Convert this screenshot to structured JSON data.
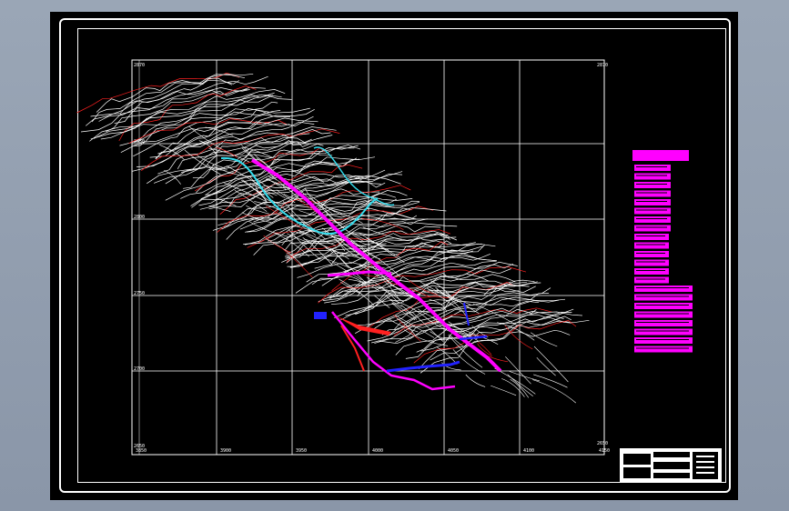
{
  "drawing": {
    "grid_labels_x": [
      "3850",
      "3900",
      "3950",
      "4000",
      "4050",
      "4100",
      "4150"
    ],
    "grid_labels_y": [
      "2870",
      "2850",
      "2800",
      "2750",
      "2700",
      "2650"
    ],
    "grid_labels_right": [
      "2870",
      "2650"
    ]
  },
  "colors": {
    "background": "#000000",
    "contour": "#ffffff",
    "contour_red": "#ff2020",
    "road_magenta": "#ff00ff",
    "river_cyan": "#33ddee",
    "water_blue": "#2222ff",
    "frame": "#ffffff"
  },
  "legend": {
    "rows": 22
  },
  "title_block": {
    "cells": [
      "",
      "",
      "",
      "",
      "",
      ""
    ]
  }
}
